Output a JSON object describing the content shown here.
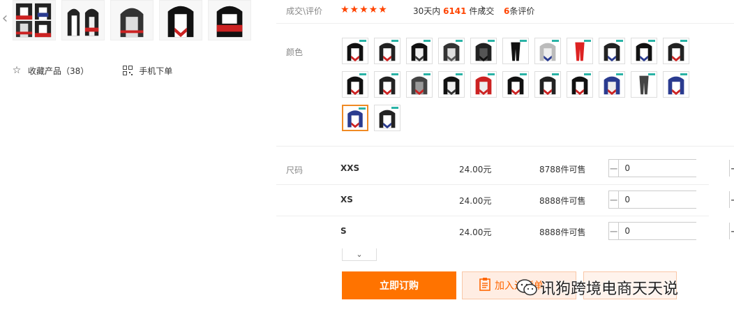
{
  "gallery": {
    "prev_arrow": "‹",
    "next_arrow": "›"
  },
  "left_actions": {
    "favorite_label": "收藏产品（38）",
    "mobile_label": "手机下单"
  },
  "reviews": {
    "label": "成交\\评价",
    "stars": "★★★★★",
    "deal_prefix": "30天内",
    "deal_count": "6141",
    "deal_suffix": "件成交",
    "review_count": "6",
    "review_suffix": "条评价"
  },
  "colors": {
    "label": "颜色",
    "selected_index": 22,
    "swatch_count": 24
  },
  "sizes": {
    "label": "尺码",
    "rows": [
      {
        "name": "XXS",
        "price": "24.00元",
        "stock": "8788件可售",
        "qty": "0"
      },
      {
        "name": "XS",
        "price": "24.00元",
        "stock": "8888件可售",
        "qty": "0"
      },
      {
        "name": "S",
        "price": "24.00元",
        "stock": "8888件可售",
        "qty": "0"
      }
    ],
    "minus": "−",
    "plus": "+",
    "expand": "⌄"
  },
  "actions": {
    "order_label": "立即订购",
    "cart_label": "加入进货单"
  },
  "watermark": "讯狗跨境电商天天说",
  "colors_theme": {
    "accent": "#ff7300",
    "star": "#ff4400",
    "highlight": "#f08a24"
  }
}
